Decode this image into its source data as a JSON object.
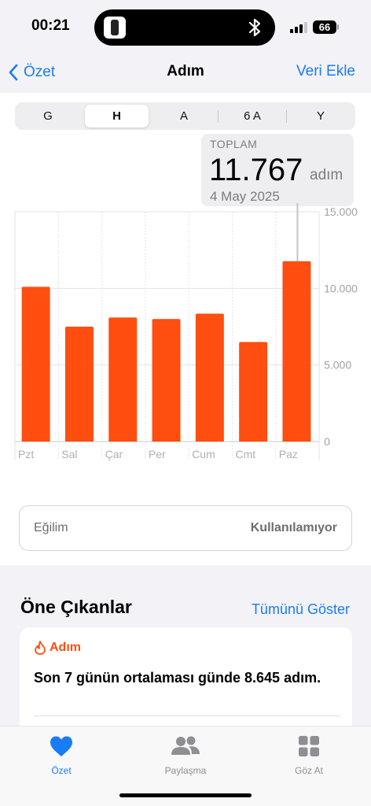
{
  "status": {
    "time": "00:21",
    "battery": "66"
  },
  "nav": {
    "back_label": "Özet",
    "title": "Adım",
    "right_label": "Veri Ekle"
  },
  "segments": [
    "G",
    "H",
    "A",
    "6 A",
    "Y"
  ],
  "selected_segment": "H",
  "total": {
    "label": "TOPLAM",
    "value": "11.767",
    "unit": "adım",
    "date": "4 May 2025"
  },
  "chart_data": {
    "type": "bar",
    "categories": [
      "Pzt",
      "Sal",
      "Çar",
      "Per",
      "Cum",
      "Cmt",
      "Paz"
    ],
    "values": [
      10100,
      7500,
      8100,
      8000,
      8350,
      6500,
      11767
    ],
    "y_ticks": [
      "15.000",
      "10.000",
      "5.000",
      "0"
    ],
    "ylim": [
      0,
      15000
    ],
    "highlighted_category": "Paz",
    "bar_color": "#ff4e10",
    "grid": true
  },
  "trend": {
    "label": "Eğilim",
    "value": "Kullanılamıyor"
  },
  "highlights": {
    "title": "Öne Çıkanlar",
    "show_all": "Tümünü Göster",
    "card": {
      "category": "Adım",
      "text": "Son 7 günün ortalaması günde 8.645 adım."
    }
  },
  "tabbar": [
    {
      "label": "Özet",
      "icon": "heart-icon",
      "active": true
    },
    {
      "label": "Paylaşma",
      "icon": "people-icon",
      "active": false
    },
    {
      "label": "Göz At",
      "icon": "grid-icon",
      "active": false
    }
  ],
  "colors": {
    "accent": "#1a7cf5",
    "bar": "#ff4e10"
  }
}
